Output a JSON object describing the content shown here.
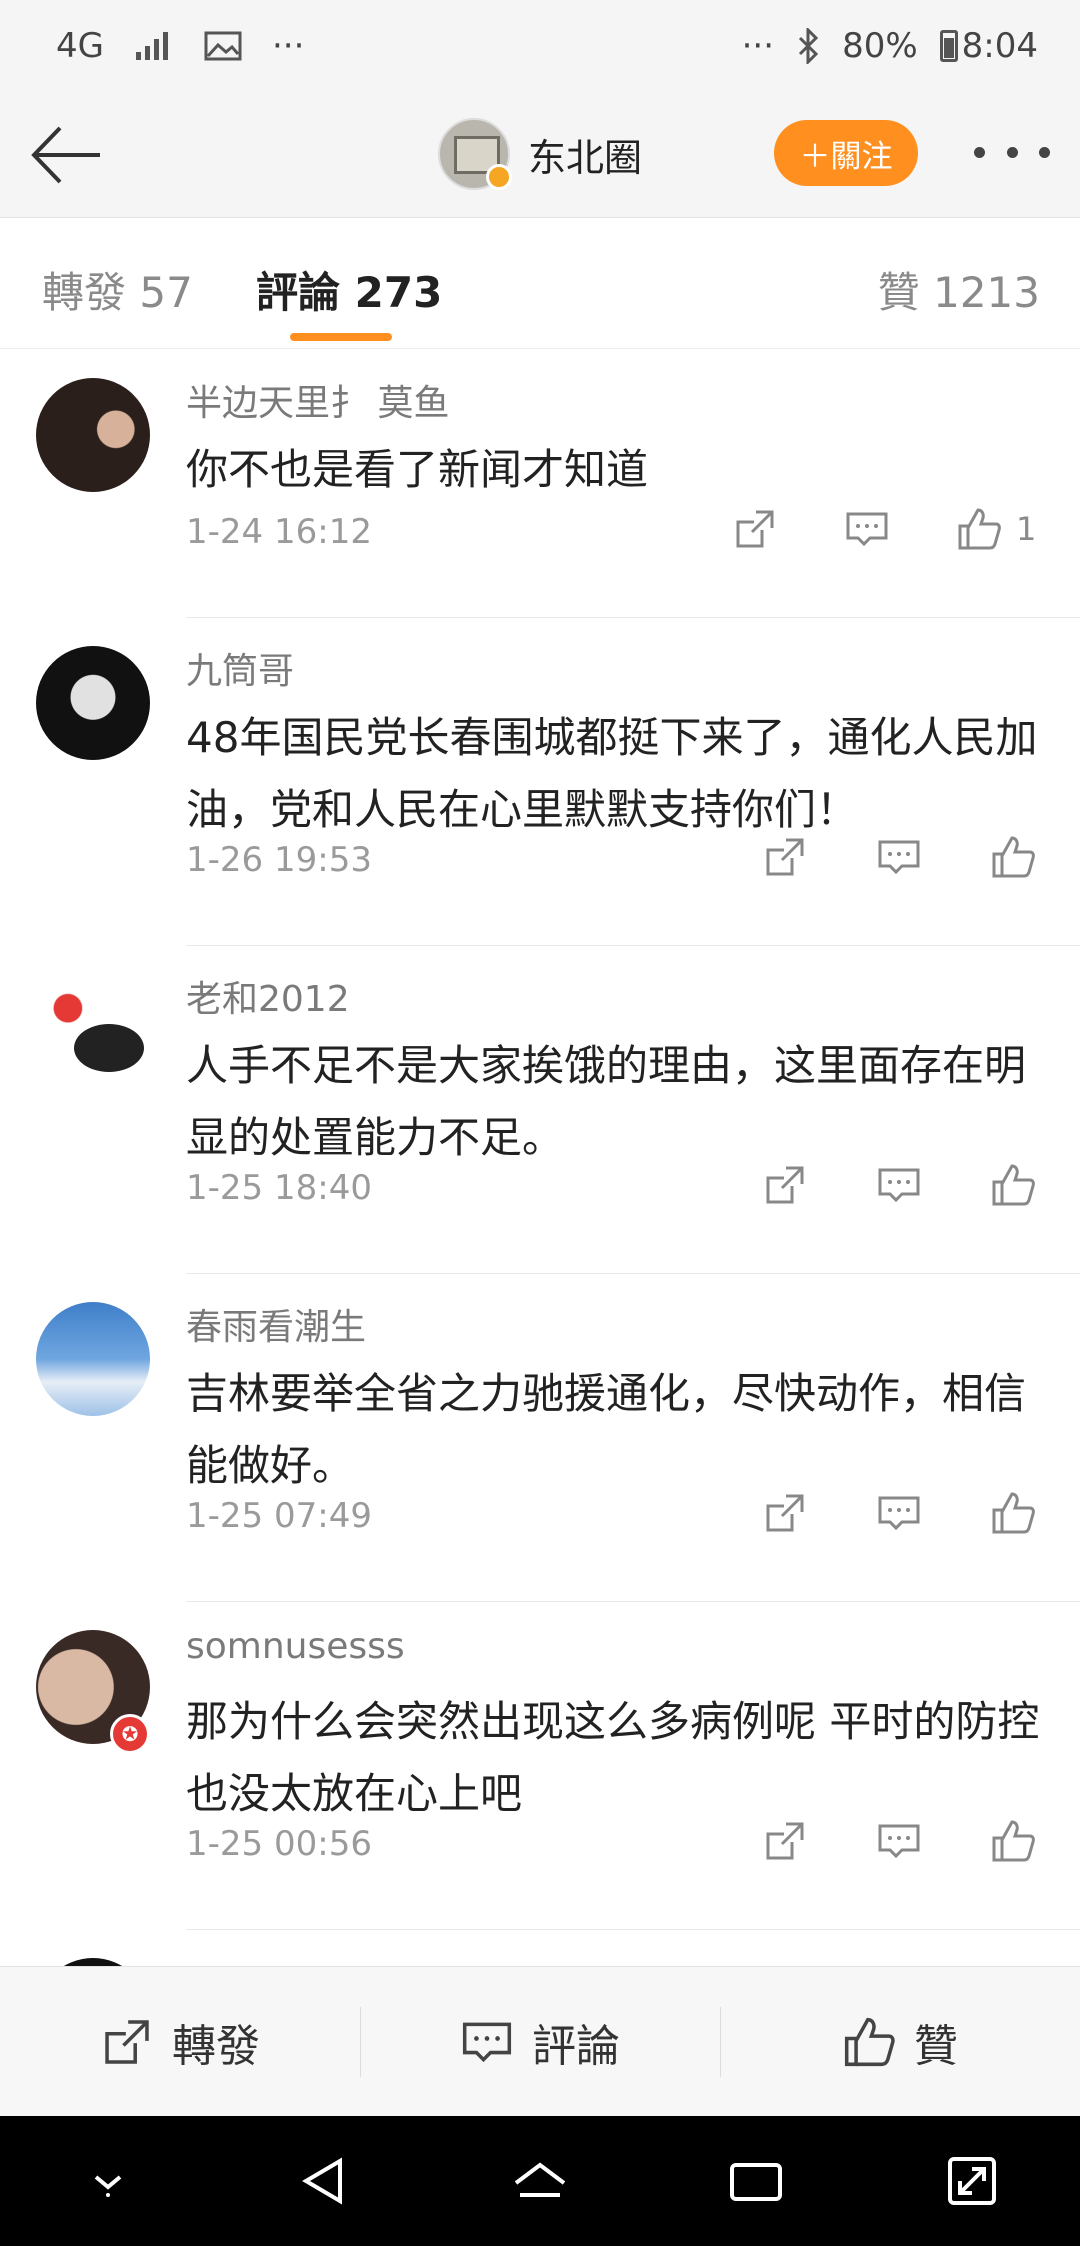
{
  "status_bar": {
    "network": "4G",
    "battery": "80%",
    "time": "8:04"
  },
  "nav": {
    "title": "东北圈",
    "follow_label": "＋關注"
  },
  "tabs": {
    "repost": "轉發 57",
    "comment": "評論 273",
    "like": "贊 1213"
  },
  "comments": [
    {
      "name": "半边天里扌 莫鱼",
      "text": "你不也是看了新闻才知道",
      "time": "1-24 16:12",
      "likes": "1"
    },
    {
      "name": "九筒哥",
      "text": "48年国民党长春围城都挺下来了，通化人民加油，党和人民在心里默默支持你们！",
      "time": "1-26 19:53",
      "likes": ""
    },
    {
      "name": "老和2012",
      "text": "人手不足不是大家挨饿的理由，这里面存在明显的处置能力不足。",
      "time": "1-25 18:40",
      "likes": ""
    },
    {
      "name": "春雨看潮生",
      "text": "吉林要举全省之力驰援通化，尽快动作，相信能做好。",
      "time": "1-25 07:49",
      "likes": ""
    },
    {
      "name": "somnusesss",
      "text": "那为什么会突然出现这么多病例呢 平时的防控也没太放在心上吧",
      "time": "1-25 00:56",
      "likes": ""
    }
  ],
  "toolbar": {
    "repost": "轉發",
    "comment": "評論",
    "like": "贊"
  }
}
